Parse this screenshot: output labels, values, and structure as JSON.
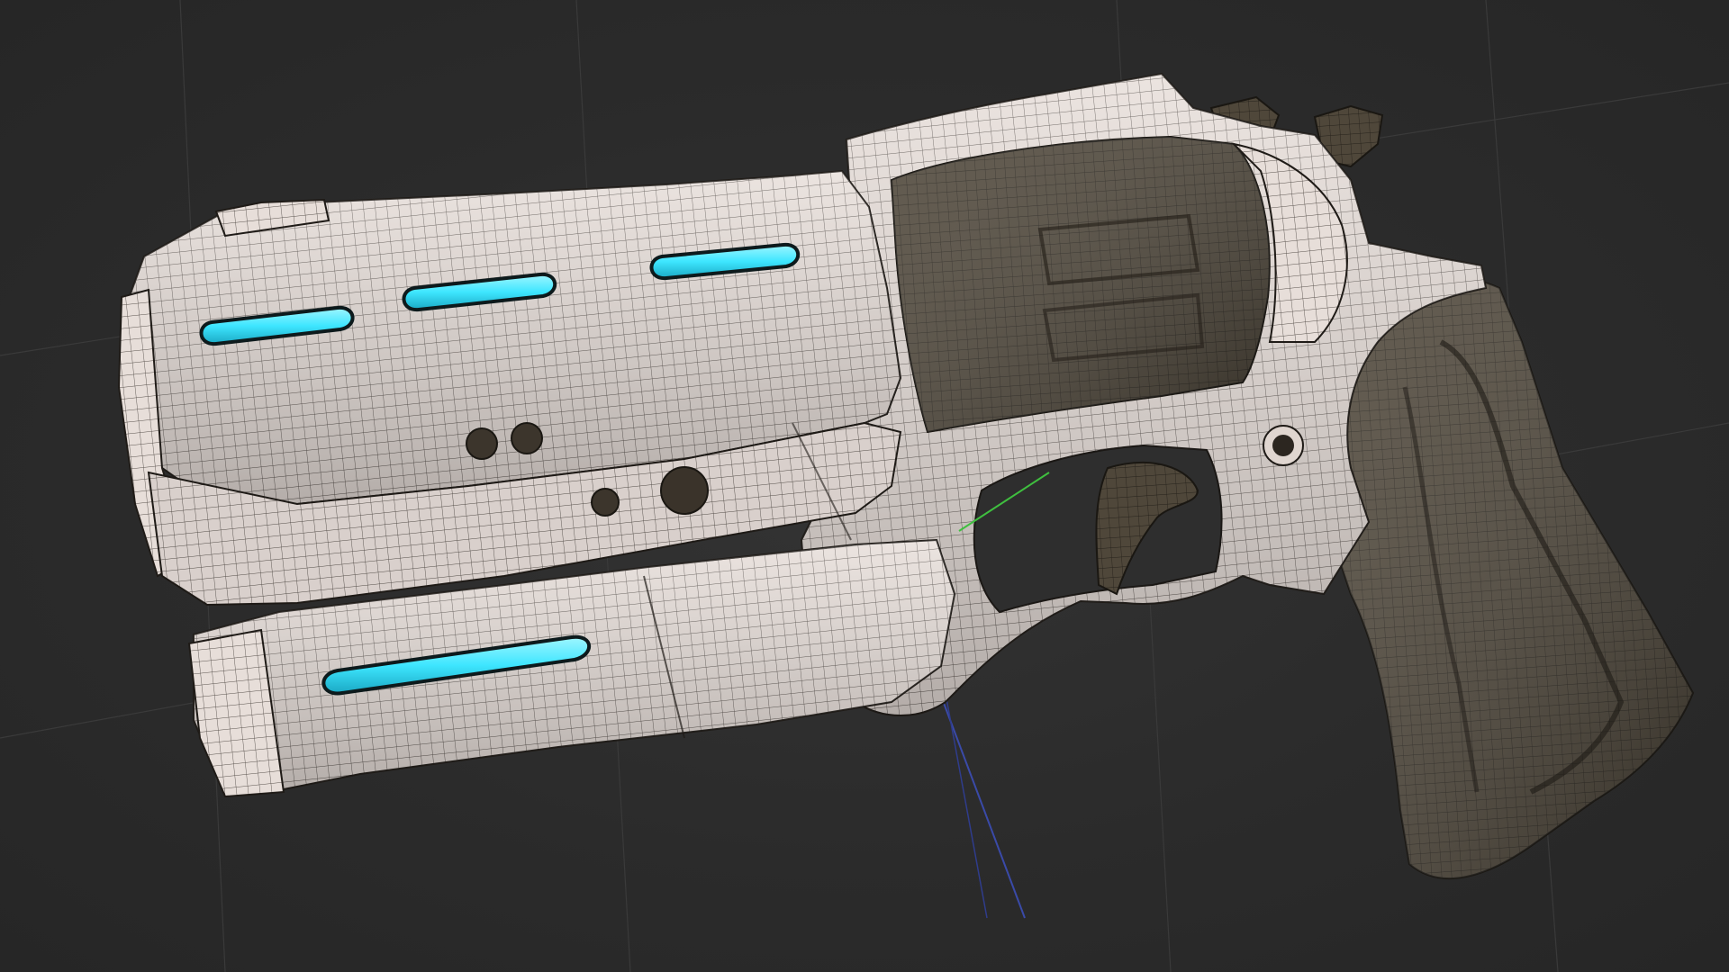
{
  "viewport": {
    "background": "#2b2b2b",
    "grid_color": "#3a3a3a",
    "axis_y_color": "#3fbf3f",
    "axis_z_color": "#3a4aa8"
  },
  "model": {
    "name": "",
    "body_color": "#e6ddd8",
    "dark_part_color": "#4a4236",
    "glow_color": "#3ee6ff",
    "wire_color": "#1e1a16",
    "icon": "revolver-model-icon"
  }
}
